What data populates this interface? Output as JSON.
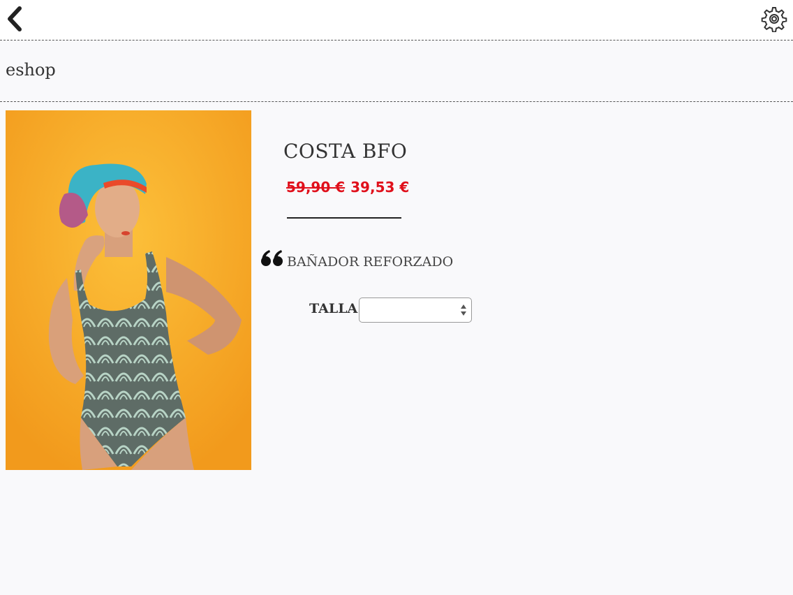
{
  "topbar": {
    "back_icon": "chevron-left-icon",
    "settings_icon": "gear-icon"
  },
  "shop": {
    "title": "eshop"
  },
  "product": {
    "name": "COSTA BFO",
    "old_price": "59,90 €",
    "new_price": "39,53 €",
    "description": "BAÑADOR REFORZADO",
    "size_label": "TALLA",
    "size_selected": "",
    "image": "product-photo-swimsuit"
  },
  "colors": {
    "sale_red": "#e0101b",
    "image_background": "#f6a623"
  }
}
